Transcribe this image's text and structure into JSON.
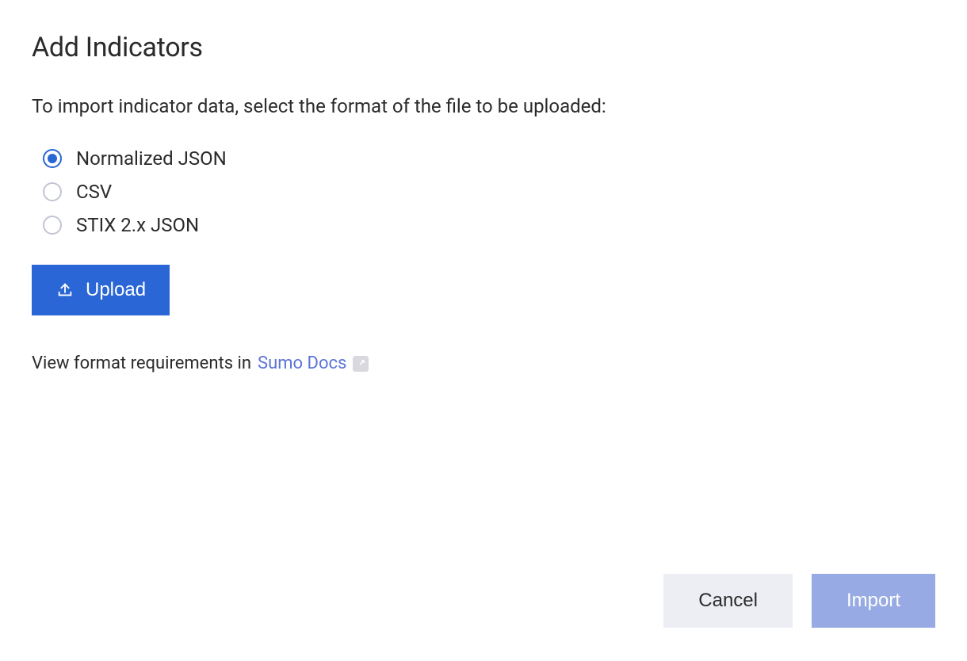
{
  "dialog": {
    "title": "Add Indicators",
    "instructions": "To import indicator data, select the format of the file to be uploaded:",
    "formats": [
      {
        "label": "Normalized JSON",
        "selected": true
      },
      {
        "label": "CSV",
        "selected": false
      },
      {
        "label": "STIX 2.x JSON",
        "selected": false
      }
    ],
    "upload_label": "Upload",
    "format_note_prefix": "View format requirements in",
    "doc_link_text": "Sumo Docs"
  },
  "footer": {
    "cancel_label": "Cancel",
    "import_label": "Import"
  }
}
